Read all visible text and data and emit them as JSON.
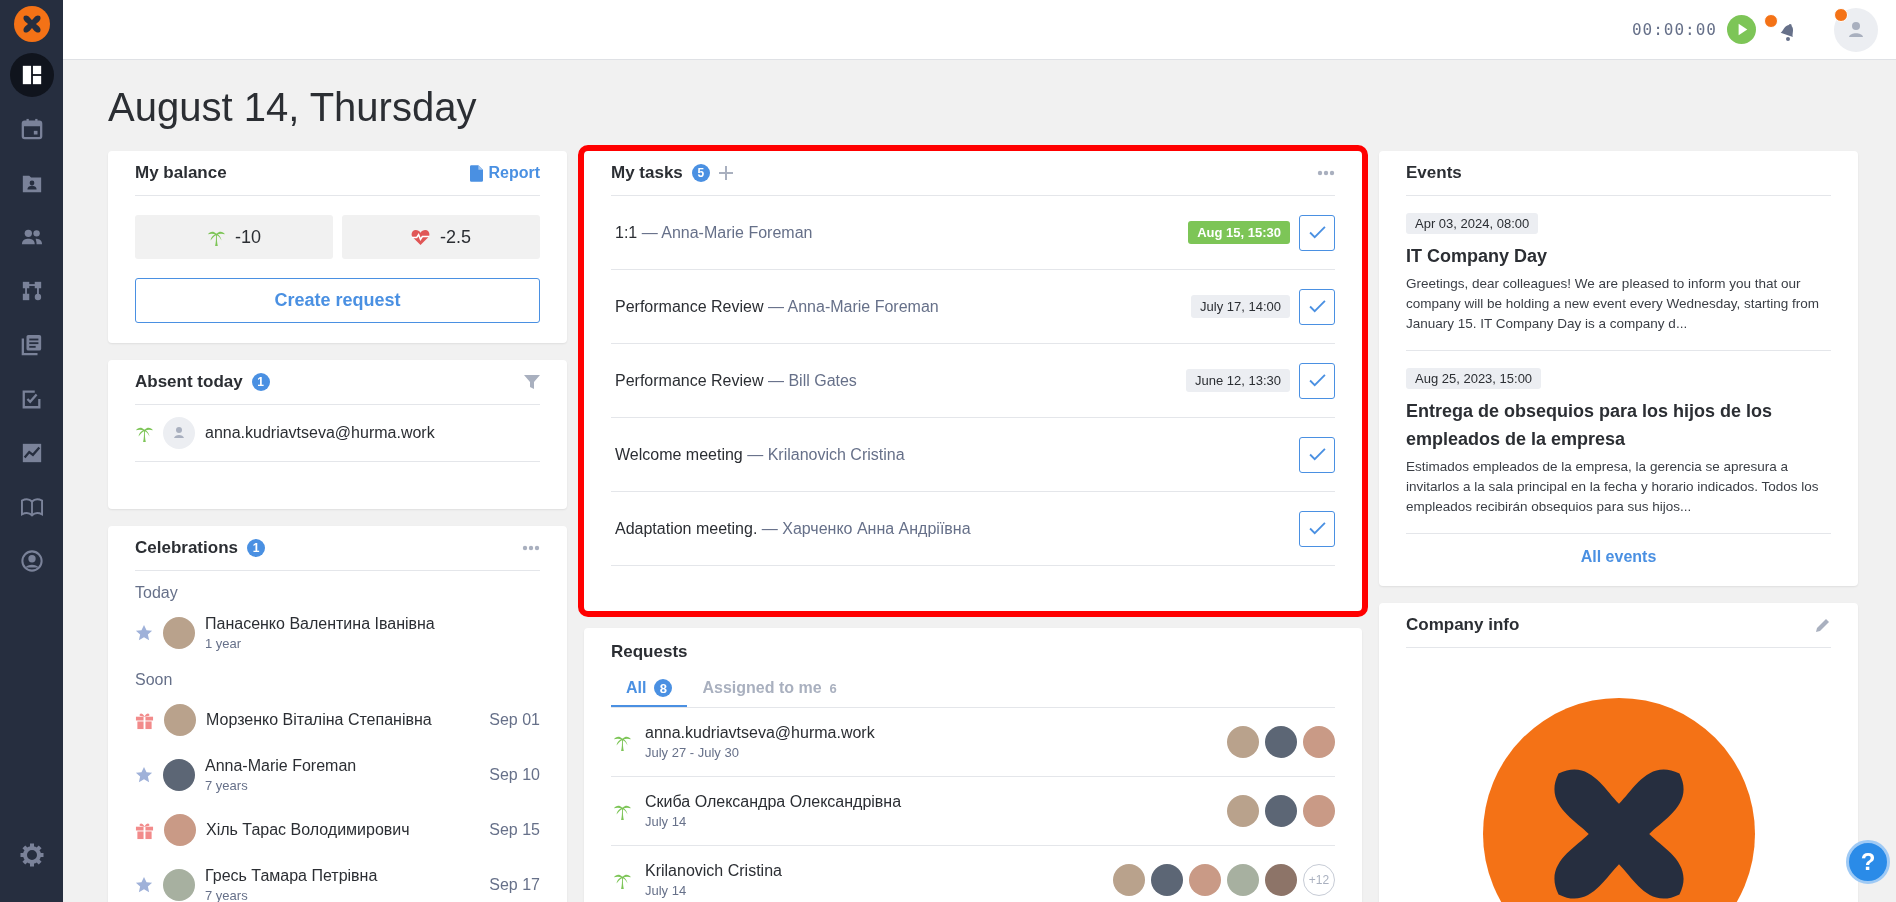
{
  "sidebar": {
    "items": [
      {
        "selected": true
      },
      {
        "selected": false
      },
      {
        "selected": false
      },
      {
        "selected": false
      },
      {
        "selected": false
      },
      {
        "selected": false
      },
      {
        "selected": false
      },
      {
        "selected": false
      },
      {
        "selected": false
      },
      {
        "selected": false
      }
    ]
  },
  "header": {
    "timer": "00:00:00",
    "notifications_unread": true,
    "profile_unread": true
  },
  "page_title": "August 14, Thursday",
  "balance": {
    "title": "My balance",
    "report_link": "Report",
    "vacation": "-10",
    "sick": "-2.5",
    "create_button": "Create request"
  },
  "absent": {
    "title": "Absent today",
    "count": "1",
    "people": [
      {
        "name": "anna.kudriavtseva@hurma.work"
      }
    ]
  },
  "celebrations": {
    "title": "Celebrations",
    "count": "1",
    "groups": [
      {
        "label": "Today",
        "people": [
          {
            "kind": "anniversary",
            "name": "Панасенко Валентина Іванівна",
            "detail": "1 year"
          }
        ]
      },
      {
        "label": "Soon",
        "people": [
          {
            "kind": "birthday",
            "name": "Морзенко Віталіна Степанівна",
            "date": "Sep 01"
          },
          {
            "kind": "anniversary",
            "name": "Anna-Marie Foreman",
            "detail": "7 years",
            "date": "Sep 10"
          },
          {
            "kind": "birthday",
            "name": "Хіль Тарас Володимирович",
            "date": "Sep 15"
          },
          {
            "kind": "anniversary",
            "name": "Гресь Тамара Петрівна",
            "detail": "7 years",
            "date": "Sep 17"
          }
        ]
      }
    ]
  },
  "tasks": {
    "title": "My tasks",
    "count": "5",
    "highlighted": true,
    "items": [
      {
        "title": "1:1",
        "person": "— Anna-Marie Foreman",
        "due": "Aug 15, 15:30",
        "upcoming": true
      },
      {
        "title": "Performance Review",
        "person": "— Anna-Marie Foreman",
        "due": "July 17, 14:00",
        "upcoming": false
      },
      {
        "title": "Performance Review",
        "person": "— Bill Gates",
        "due": "June 12, 13:30",
        "upcoming": false
      },
      {
        "title": "Welcome meeting",
        "person": "— Krilanovich Cristina"
      },
      {
        "title": "Adaptation meeting.",
        "person": "— Харченко Анна Андріївна"
      }
    ]
  },
  "requests": {
    "title": "Requests",
    "tabs": [
      {
        "label": "All",
        "count": "8",
        "selected": true
      },
      {
        "label": "Assigned to me",
        "count": "6",
        "selected": false
      }
    ],
    "items": [
      {
        "name": "anna.kudriavtseva@hurma.work",
        "dates": "July 27 - July 30",
        "approvers": [
          {
            "kind": "photo"
          },
          {
            "kind": "photo"
          },
          {
            "kind": "photo"
          }
        ]
      },
      {
        "name": "Скиба Олександра Олександрівна",
        "dates": "July 14",
        "approvers": [
          {
            "kind": "photo"
          },
          {
            "kind": "photo"
          },
          {
            "kind": "photo"
          }
        ]
      },
      {
        "name": "Krilanovich Cristina",
        "dates": "July 14",
        "approvers": [
          {
            "kind": "photo"
          },
          {
            "kind": "photo"
          },
          {
            "kind": "photo"
          },
          {
            "kind": "photo"
          },
          {
            "kind": "photo"
          },
          {
            "kind": "more",
            "label": "+12"
          }
        ]
      }
    ]
  },
  "events": {
    "title": "Events",
    "items": [
      {
        "date": "Apr 03, 2024, 08:00",
        "title": "IT Company Day",
        "summary": "Greetings, dear colleagues! We are pleased to inform you that our company will be holding a new event every Wednesday, starting from January 15. IT Company Day is a company d..."
      },
      {
        "date": "Aug 25, 2023, 15:00",
        "title": "Entrega de obsequios para los hijos de los empleados de la empresa",
        "summary": "Estimados empleados de la empresa, la gerencia se apresura a invitarlos a la sala principal en la fecha y horario indicados. Todos los empleados recibirán obsequios para sus hijos..."
      }
    ],
    "all_link": "All events"
  },
  "company_info": {
    "title": "Company info"
  },
  "help_button": {
    "label": "?"
  }
}
